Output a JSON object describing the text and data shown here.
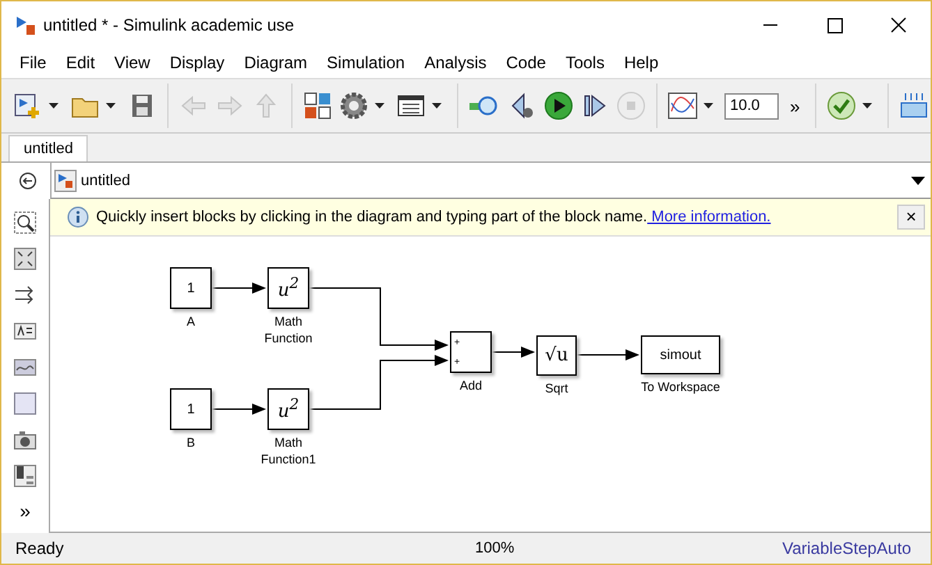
{
  "window": {
    "title": "untitled * - Simulink academic use"
  },
  "menu": [
    "File",
    "Edit",
    "View",
    "Display",
    "Diagram",
    "Simulation",
    "Analysis",
    "Code",
    "Tools",
    "Help"
  ],
  "toolbar": {
    "stop_time": "10.0",
    "more": "»"
  },
  "tabs": [
    {
      "label": "untitled",
      "selected": true
    }
  ],
  "address": {
    "path": "untitled"
  },
  "info_bar": {
    "text": "Quickly insert blocks by clicking in the diagram and typing part of the block name.",
    "link": " More information.",
    "close": "×"
  },
  "palette": {
    "more": "»"
  },
  "blocks": [
    {
      "kind": "constant",
      "text": "1",
      "label": "A"
    },
    {
      "kind": "math",
      "text": "u$^{2}$",
      "label": "Math\nFunction"
    },
    {
      "kind": "constant",
      "text": "1",
      "label": "B"
    },
    {
      "kind": "math",
      "text": "u$^{2}$",
      "label": "Math\nFunction1"
    },
    {
      "kind": "sum",
      "signs": [
        "+",
        "+"
      ],
      "label": "Add"
    },
    {
      "kind": "sqrt",
      "text": "√u",
      "label": "Sqrt"
    },
    {
      "kind": "workspace",
      "text": "simout",
      "label": "To Workspace"
    }
  ],
  "status_bar": {
    "state": "Ready",
    "zoom": "100%",
    "solver": "VariableStepAuto"
  }
}
